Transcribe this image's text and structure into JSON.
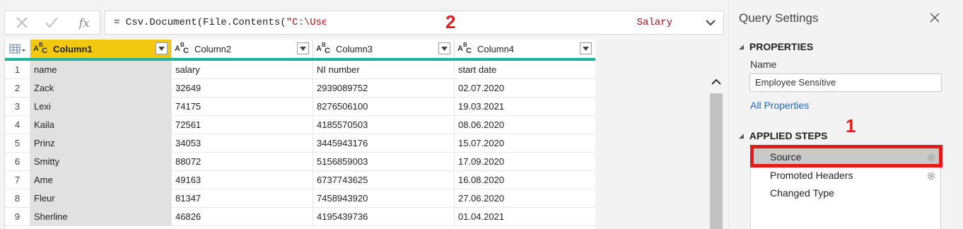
{
  "formula_bar": {
    "cancel_icon": "close-icon",
    "commit_icon": "checkmark-icon",
    "fx_label": "fx",
    "formula_prefix": "= Csv.Document(File.Contents(",
    "formula_string": "\"C:\\User",
    "formula_tail": "Salary",
    "annotation": "2"
  },
  "grid": {
    "columns": [
      {
        "type": "ABC",
        "label": "Column1"
      },
      {
        "type": "ABC",
        "label": "Column2"
      },
      {
        "type": "ABC",
        "label": "Column3"
      },
      {
        "type": "ABC",
        "label": "Column4"
      }
    ],
    "rows": [
      {
        "n": "1",
        "cells": [
          "name",
          "salary",
          "NI number",
          "start date"
        ]
      },
      {
        "n": "2",
        "cells": [
          "Zack",
          "32649",
          "2939089752",
          "02.07.2020"
        ]
      },
      {
        "n": "3",
        "cells": [
          "Lexi",
          "74175",
          "8276506100",
          "19.03.2021"
        ]
      },
      {
        "n": "4",
        "cells": [
          "Kaila",
          "72561",
          "4185570503",
          "08.06.2020"
        ]
      },
      {
        "n": "5",
        "cells": [
          "Prinz",
          "34053",
          "3445943176",
          "15.07.2020"
        ]
      },
      {
        "n": "6",
        "cells": [
          "Smitty",
          "88072",
          "5156859003",
          "17.09.2020"
        ]
      },
      {
        "n": "7",
        "cells": [
          "Ame",
          "49163",
          "6737743625",
          "16.08.2020"
        ]
      },
      {
        "n": "8",
        "cells": [
          "Fleur",
          "81347",
          "7458943920",
          "27.06.2020"
        ]
      },
      {
        "n": "9",
        "cells": [
          "Sherline",
          "46826",
          "4195439736",
          "01.04.2021"
        ]
      }
    ]
  },
  "query_settings": {
    "title": "Query Settings",
    "properties_heading": "PROPERTIES",
    "name_label": "Name",
    "name_value": "Employee Sensitive",
    "all_properties_link": "All Properties",
    "applied_steps_heading": "APPLIED STEPS",
    "steps": [
      "Source",
      "Promoted Headers",
      "Changed Type"
    ],
    "annotation": "1"
  },
  "colors": {
    "active_column": "#f2c811",
    "header_underline": "#1db39c",
    "annotation_red": "#e21c1c",
    "link_blue": "#1d66c4"
  }
}
